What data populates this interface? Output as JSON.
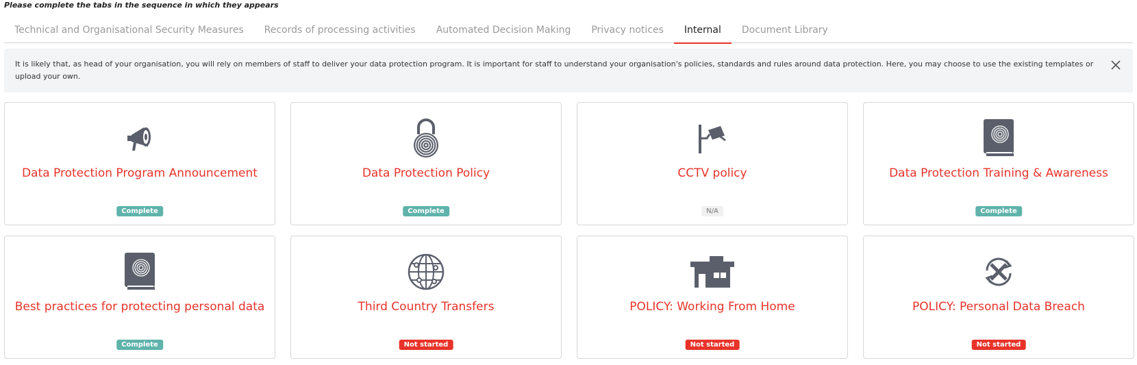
{
  "instruction": "Please complete the tabs in the sequence in which they appears",
  "tabs": [
    {
      "label": "Technical and Organisational Security Measures",
      "active": false
    },
    {
      "label": "Records of processing activities",
      "active": false
    },
    {
      "label": "Automated Decision Making",
      "active": false
    },
    {
      "label": "Privacy notices",
      "active": false
    },
    {
      "label": "Internal",
      "active": true
    },
    {
      "label": "Document Library",
      "active": false
    }
  ],
  "banner": {
    "text": "It is likely that, as head of your organisation, you will rely on members of staff to deliver your data protection program. It is important for staff to understand your organisation's policies, standards and rules around data protection. Here, you may choose to use the existing templates or upload your own.",
    "close_icon": "close-icon"
  },
  "colors": {
    "accent": "#e8332a",
    "complete": "#5fb3ab",
    "not_started": "#e8332a",
    "icon": "#5b5f6b"
  },
  "cards": [
    {
      "title": "Data Protection Program Announcement",
      "status": "Complete",
      "status_kind": "complete",
      "icon": "megaphone-icon"
    },
    {
      "title": "Data Protection Policy",
      "status": "Complete",
      "status_kind": "complete",
      "icon": "fingerprint-lock-icon"
    },
    {
      "title": "CCTV policy",
      "status": "N/A",
      "status_kind": "na",
      "icon": "cctv-camera-icon"
    },
    {
      "title": "Data Protection Training & Awareness",
      "status": "Complete",
      "status_kind": "complete",
      "icon": "fingerprint-book-icon"
    },
    {
      "title": "Best practices for protecting personal data",
      "status": "Complete",
      "status_kind": "complete",
      "icon": "fingerprint-book-icon"
    },
    {
      "title": "Third Country Transfers",
      "status": "Not started",
      "status_kind": "notstarted",
      "icon": "globe-network-icon"
    },
    {
      "title": "POLICY: Working From Home",
      "status": "Not started",
      "status_kind": "notstarted",
      "icon": "house-icon"
    },
    {
      "title": "POLICY: Personal Data Breach",
      "status": "Not started",
      "status_kind": "notstarted",
      "icon": "breach-cycle-icon"
    }
  ]
}
